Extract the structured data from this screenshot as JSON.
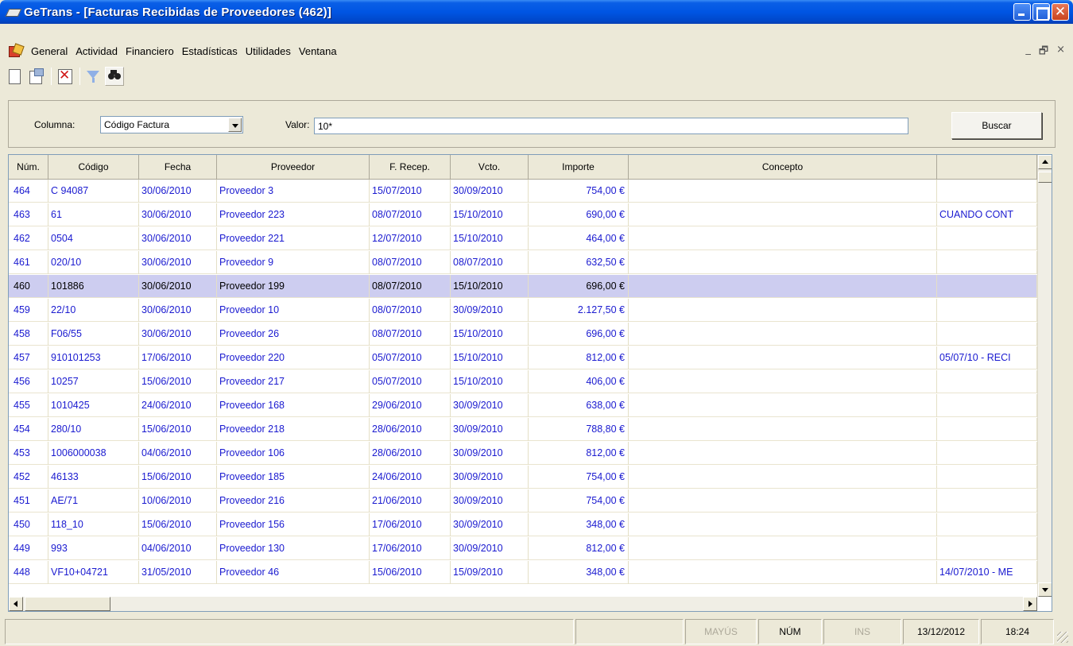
{
  "window": {
    "title": "GeTrans - [Facturas Recibidas de Proveedores (462)]"
  },
  "menu": {
    "items": [
      {
        "label": "General",
        "accel": "G"
      },
      {
        "label": "Actividad",
        "accel": "A"
      },
      {
        "label": "Financiero",
        "accel": ""
      },
      {
        "label": "Estadísticas",
        "accel": "s"
      },
      {
        "label": "Utilidades",
        "accel": "U"
      },
      {
        "label": "Ventana",
        "accel": "V"
      }
    ],
    "mdi_min": "_",
    "mdi_restore": "🗗",
    "mdi_close": "×"
  },
  "search": {
    "column_label": "Columna:",
    "column_value": "Código Factura",
    "value_label": "Valor:",
    "value": "10*",
    "button_label": "Buscar"
  },
  "table": {
    "headers": [
      "Núm.",
      "Código",
      "Fecha",
      "Proveedor",
      "F. Recep.",
      "Vcto.",
      "Importe",
      "Concepto",
      ""
    ],
    "rows": [
      [
        "464",
        "C 94087",
        "30/06/2010",
        "Proveedor 3",
        "15/07/2010",
        "30/09/2010",
        "754,00 €",
        "",
        ""
      ],
      [
        "463",
        "61",
        "30/06/2010",
        "Proveedor 223",
        "08/07/2010",
        "15/10/2010",
        "690,00 €",
        "",
        "CUANDO CONT"
      ],
      [
        "462",
        "0504",
        "30/06/2010",
        "Proveedor 221",
        "12/07/2010",
        "15/10/2010",
        "464,00 €",
        "",
        ""
      ],
      [
        "461",
        "020/10",
        "30/06/2010",
        "Proveedor 9",
        "08/07/2010",
        "08/07/2010",
        "632,50 €",
        "",
        ""
      ],
      [
        "460",
        "101886",
        "30/06/2010",
        "Proveedor 199",
        "08/07/2010",
        "15/10/2010",
        "696,00 €",
        "",
        ""
      ],
      [
        "459",
        "22/10",
        "30/06/2010",
        "Proveedor 10",
        "08/07/2010",
        "30/09/2010",
        "2.127,50 €",
        "",
        ""
      ],
      [
        "458",
        "F06/55",
        "30/06/2010",
        "Proveedor 26",
        "08/07/2010",
        "15/10/2010",
        "696,00 €",
        "",
        ""
      ],
      [
        "457",
        "910101253",
        "17/06/2010",
        "Proveedor 220",
        "05/07/2010",
        "15/10/2010",
        "812,00 €",
        "",
        "05/07/10 - RECI"
      ],
      [
        "456",
        "10257",
        "15/06/2010",
        "Proveedor 217",
        "05/07/2010",
        "15/10/2010",
        "406,00 €",
        "",
        ""
      ],
      [
        "455",
        "1010425",
        "24/06/2010",
        "Proveedor 168",
        "29/06/2010",
        "30/09/2010",
        "638,00 €",
        "",
        ""
      ],
      [
        "454",
        "280/10",
        "15/06/2010",
        "Proveedor 218",
        "28/06/2010",
        "30/09/2010",
        "788,80 €",
        "",
        ""
      ],
      [
        "453",
        "1006000038",
        "04/06/2010",
        "Proveedor 106",
        "28/06/2010",
        "30/09/2010",
        "812,00 €",
        "",
        ""
      ],
      [
        "452",
        "46133",
        "15/06/2010",
        "Proveedor 185",
        "24/06/2010",
        "30/09/2010",
        "754,00 €",
        "",
        ""
      ],
      [
        "451",
        "AE/71",
        "10/06/2010",
        "Proveedor 216",
        "21/06/2010",
        "30/09/2010",
        "754,00 €",
        "",
        ""
      ],
      [
        "450",
        "118_10",
        "15/06/2010",
        "Proveedor 156",
        "17/06/2010",
        "30/09/2010",
        "348,00 €",
        "",
        ""
      ],
      [
        "449",
        "993",
        "04/06/2010",
        "Proveedor 130",
        "17/06/2010",
        "30/09/2010",
        "812,00 €",
        "",
        ""
      ],
      [
        "448",
        "VF10+04721",
        "31/05/2010",
        "Proveedor 46",
        "15/06/2010",
        "15/09/2010",
        "348,00 €",
        "",
        "14/07/2010 - ME"
      ]
    ],
    "selected_row": 4
  },
  "status": {
    "mayus": "MAYÚS",
    "num": "NÚM",
    "ins": "INS",
    "date": "13/12/2012",
    "time": "18:24"
  },
  "colors": {
    "title_bar": "#0055e3",
    "row_text": "#1a1ad0",
    "selected_row": "#cdcdf0",
    "window_bg": "#ece9d8"
  }
}
